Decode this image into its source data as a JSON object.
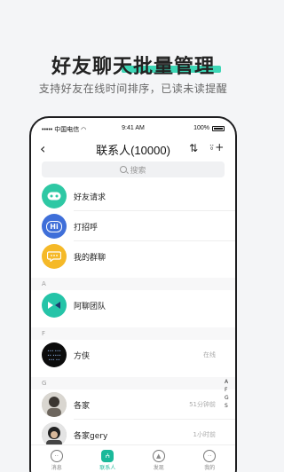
{
  "promo": {
    "headline": "好友聊天批量管理",
    "subheadline": "支持好友在线时间排序，已读未读提醒"
  },
  "status_bar": {
    "carrier": "••••• 中国电信",
    "time": "9:41 AM",
    "battery": "100%"
  },
  "nav": {
    "title": "联系人(10000)"
  },
  "search": {
    "placeholder": "搜索"
  },
  "quick_actions": [
    {
      "label": "好友请求",
      "icon": "friend-request-icon"
    },
    {
      "label": "打招呼",
      "icon": "hi-icon",
      "badge": "Hi"
    },
    {
      "label": "我的群聊",
      "icon": "group-chat-icon"
    }
  ],
  "sections": [
    {
      "letter": "A",
      "contacts": [
        {
          "name": "阿聊团队",
          "status": ""
        }
      ]
    },
    {
      "letter": "F",
      "contacts": [
        {
          "name": "方侠",
          "status": "在线"
        }
      ]
    },
    {
      "letter": "G",
      "contacts": [
        {
          "name": "各家",
          "status": "51分钟前"
        },
        {
          "name": "各家gery",
          "status": "1小时前"
        }
      ]
    }
  ],
  "index_letters": [
    "A",
    "F",
    "G",
    "S"
  ],
  "tabs": [
    {
      "label": "消息",
      "active": false
    },
    {
      "label": "联系人",
      "active": true
    },
    {
      "label": "发现",
      "active": false
    },
    {
      "label": "我的",
      "active": false
    }
  ],
  "colors": {
    "accent": "#1bb99a",
    "headline_bar": "#3cd6b5",
    "friend_request": "#2ec8a4",
    "hi": "#3f6fd9",
    "group_chat": "#f5b928"
  }
}
